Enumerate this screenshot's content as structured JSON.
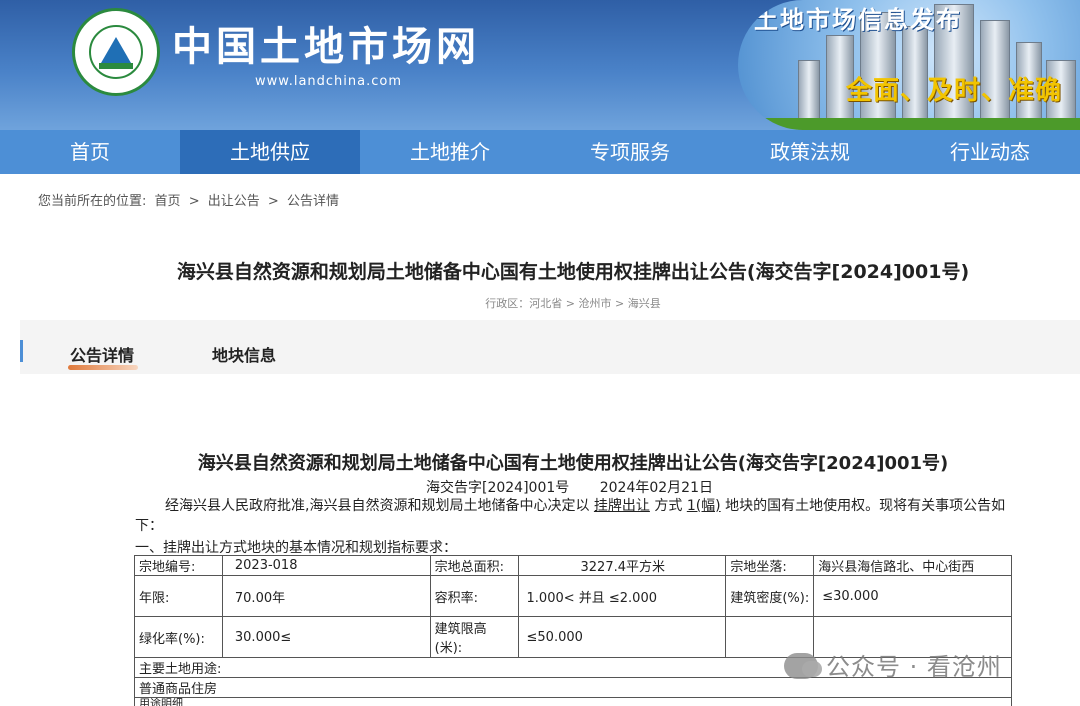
{
  "header": {
    "site_title": "中国土地市场网",
    "site_url": "www.landchina.com",
    "banner_title": "土地市场信息发布",
    "banner_slogan": "全面、及时、准确",
    "colors": {
      "header_blue": "#2f5fa6",
      "nav_blue": "#4d8fd6",
      "nav_active": "#2d6db8"
    }
  },
  "nav": {
    "items": [
      {
        "label": "首页"
      },
      {
        "label": "土地供应"
      },
      {
        "label": "土地推介"
      },
      {
        "label": "专项服务"
      },
      {
        "label": "政策法规"
      },
      {
        "label": "行业动态"
      }
    ],
    "active_index": 1
  },
  "breadcrumb": {
    "prefix": "您当前所在的位置:",
    "items": [
      "首页",
      "出让公告",
      "公告详情"
    ],
    "separator": ">"
  },
  "page": {
    "title": "海兴县自然资源和规划局土地储备中心国有土地使用权挂牌出让公告(海交告字[2024]001号)",
    "region": "行政区：河北省 > 沧州市 > 海兴县"
  },
  "tabs": [
    {
      "label": "公告详情",
      "active": true
    },
    {
      "label": "地块信息",
      "active": false
    }
  ],
  "announcement": {
    "title": "海兴县自然资源和规划局土地储备中心国有土地使用权挂牌出让公告(海交告字[2024]001号)",
    "doc_no": "海交告字[2024]001号",
    "date": "2024年02月21日",
    "para_a": "经海兴县人民政府批准,海兴县自然资源和规划局土地储备中心决定以",
    "para_method": "挂牌出让",
    "para_b": "方式",
    "para_count": "1(幅)",
    "para_c": "地块的国有土地使用权。现将有关事项公告如下：",
    "section1": "一、挂牌出让方式地块的基本情况和规划指标要求："
  },
  "table": {
    "parcel_no_label": "宗地编号:",
    "parcel_no": "2023-018",
    "area_label": "宗地总面积:",
    "area": "3227.4平方米",
    "location_label": "宗地坐落:",
    "location": "海兴县海信路北、中心街西",
    "term_label": "年限:",
    "term": "70.00年",
    "far_label": "容积率:",
    "far": "1.000< 并且 ≤2.000",
    "density_label": "建筑密度(%):",
    "density": "≤30.000",
    "green_label": "绿化率(%):",
    "green": "30.000≤",
    "height_label": "建筑限高(米):",
    "height": "≤50.000",
    "use_label": "主要土地用途:",
    "use": "普通商品住房",
    "next_row": "用途明细"
  },
  "watermark": {
    "text": "公众号 · 看沧州"
  }
}
